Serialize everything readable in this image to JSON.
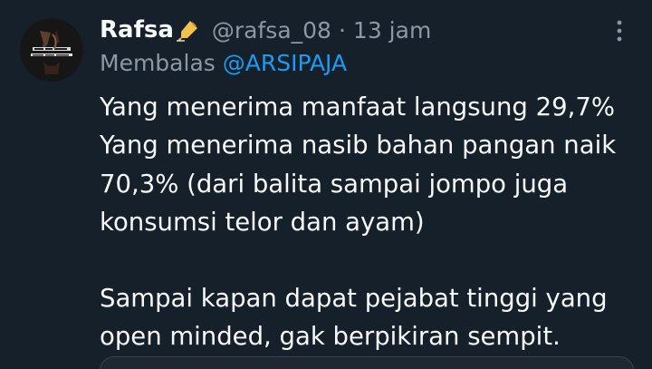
{
  "tweet": {
    "author_name": "Rafsa",
    "author_icon": "writing-hand-icon",
    "handle": "@rafsa_08",
    "separator": "·",
    "time": "13 jam",
    "reply_prefix": "Membalas",
    "reply_to": "@ARSIPAJA",
    "lines": [
      "Yang menerima manfaat langsung 29,7%",
      "Yang menerima nasib bahan pangan naik",
      "70,3% (dari balita sampai jompo juga",
      "konsumsi telor dan ayam)"
    ],
    "paragraph2_lines": [
      "Sampai kapan dapat pejabat tinggi yang",
      "open minded, gak berpikiran sempit."
    ],
    "more_icon": "more-vertical-icon"
  },
  "colors": {
    "background": "#15202b",
    "text": "#f7f9f9",
    "secondary_text": "#8b98a5",
    "link": "#1d9bf0"
  }
}
